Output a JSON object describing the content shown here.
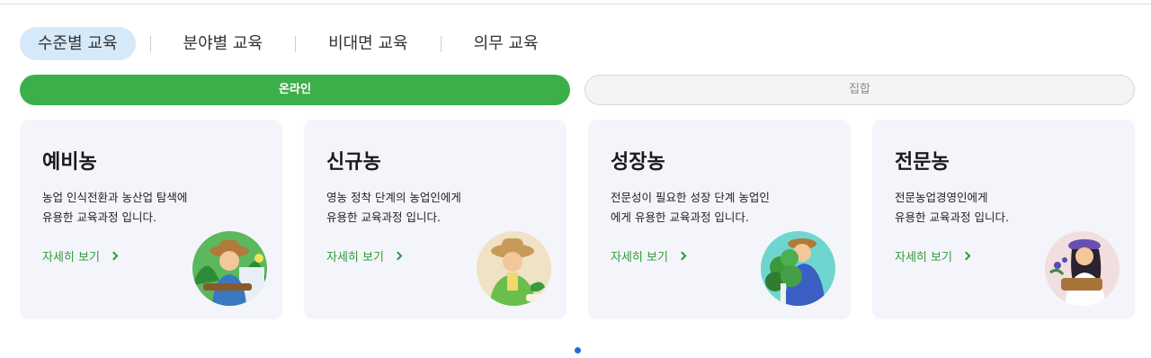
{
  "tabs": [
    {
      "label": "수준별 교육",
      "active": true
    },
    {
      "label": "분야별 교육",
      "active": false
    },
    {
      "label": "비대면 교육",
      "active": false
    },
    {
      "label": "의무 교육",
      "active": false
    }
  ],
  "mode_toggle": {
    "online": "온라인",
    "offline": "집합",
    "selected": "online"
  },
  "cards": [
    {
      "title": "예비농",
      "desc_lines": [
        "농업 인식전환과 농산업 탐색에",
        "유용한 교육과정 입니다."
      ],
      "more": "자세히 보기",
      "avatar_bg": "#5cb85c"
    },
    {
      "title": "신규농",
      "desc_lines": [
        "영농 정착 단계의 농업인에게",
        "유용한 교육과정 입니다."
      ],
      "more": "자세히 보기",
      "avatar_bg": "#f0e2c4"
    },
    {
      "title": "성장농",
      "desc_lines": [
        "전문성이 필요한 성장 단계 농업인",
        "에게 유용한 교육과정 입니다."
      ],
      "more": "자세히 보기",
      "avatar_bg": "#6fd6cf"
    },
    {
      "title": "전문농",
      "desc_lines": [
        "전문농업경영인에게",
        "유용한 교육과정 입니다."
      ],
      "more": "자세히 보기",
      "avatar_bg": "#f1dede"
    }
  ],
  "carousel": {
    "pages": 1,
    "current": 1
  },
  "colors": {
    "accent_green": "#3daf4a",
    "active_tab": "#d6e9fb",
    "card_bg": "#f4f5fa",
    "dot": "#1a6fe0"
  }
}
